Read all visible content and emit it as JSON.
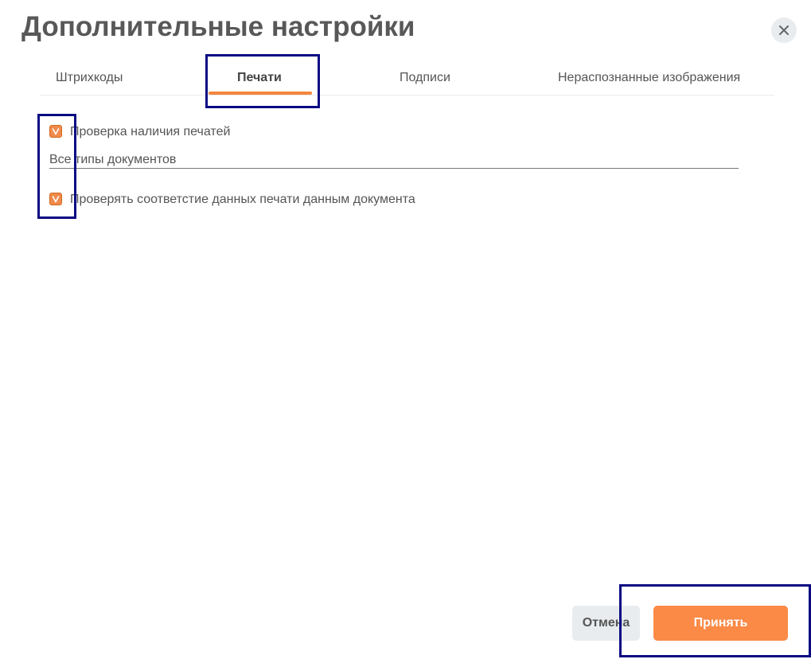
{
  "dialog": {
    "title": "Дополнительные настройки",
    "close_icon": "close-icon"
  },
  "tabs": [
    {
      "label": "Штрихкоды",
      "active": false
    },
    {
      "label": "Печати",
      "active": true
    },
    {
      "label": "Подписи",
      "active": false
    },
    {
      "label": "Нераспознанные изображения",
      "active": false
    }
  ],
  "settings": {
    "check_stamps": {
      "label": "Проверка наличия печатей",
      "checked": true
    },
    "document_types": {
      "value": "Все типы документов"
    },
    "check_stamp_data": {
      "label": "Проверять соответстие данных печати данным документа",
      "checked": true
    }
  },
  "footer": {
    "cancel_label": "Отмена",
    "accept_label": "Принять"
  },
  "colors": {
    "accent": "#fa8a46",
    "highlight_box": "#0b0a83"
  }
}
